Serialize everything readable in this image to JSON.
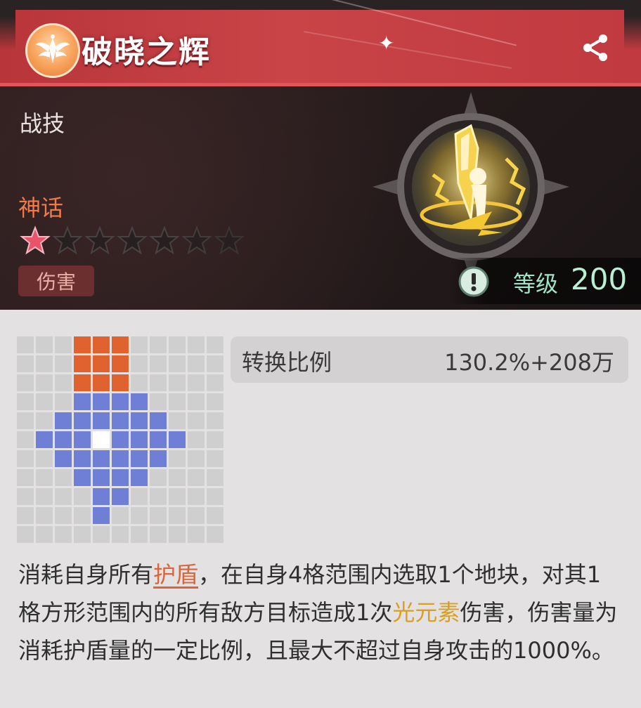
{
  "skill": {
    "title": "破晓之辉",
    "type": "战技",
    "rarity": "神话",
    "stars_filled": 1,
    "stars_total": 7,
    "tag": "伤害",
    "level_label": "等级",
    "level_value": "200"
  },
  "ratio": {
    "label": "转换比例",
    "value": "130.2%+208万"
  },
  "range_grid": [
    "...ooo.....",
    "...ooo.....",
    "...ooo.....",
    "...bbbb....",
    "..bbbbbb...",
    ".bbbwbbbb..",
    "..bbbbbb...",
    "...bbbb....",
    "....bb.....",
    "....b......",
    "..........."
  ],
  "description": {
    "part1": "消耗自身所有",
    "kw1": "护盾",
    "part2": "，在自身4格范围内选取1个地块，对其1格方形范围内的所有敌方目标造成1次",
    "kw2": "光元素",
    "part3": "伤害，伤害量为消耗护盾量的一定比例，且最大不超过自身攻击的1000%。"
  },
  "icons": {
    "emblem": "winged-emblem-icon",
    "share": "share-icon",
    "info": "exclamation-icon",
    "star": "star-icon"
  },
  "colors": {
    "header": "#c84447",
    "rarity": "#f17a4b",
    "level": "#b7f0d2",
    "orange_cell": "#e0632f",
    "blue_cell": "#6f7fd6",
    "keyword_orange": "#d9663a",
    "keyword_gold": "#d7a022"
  }
}
